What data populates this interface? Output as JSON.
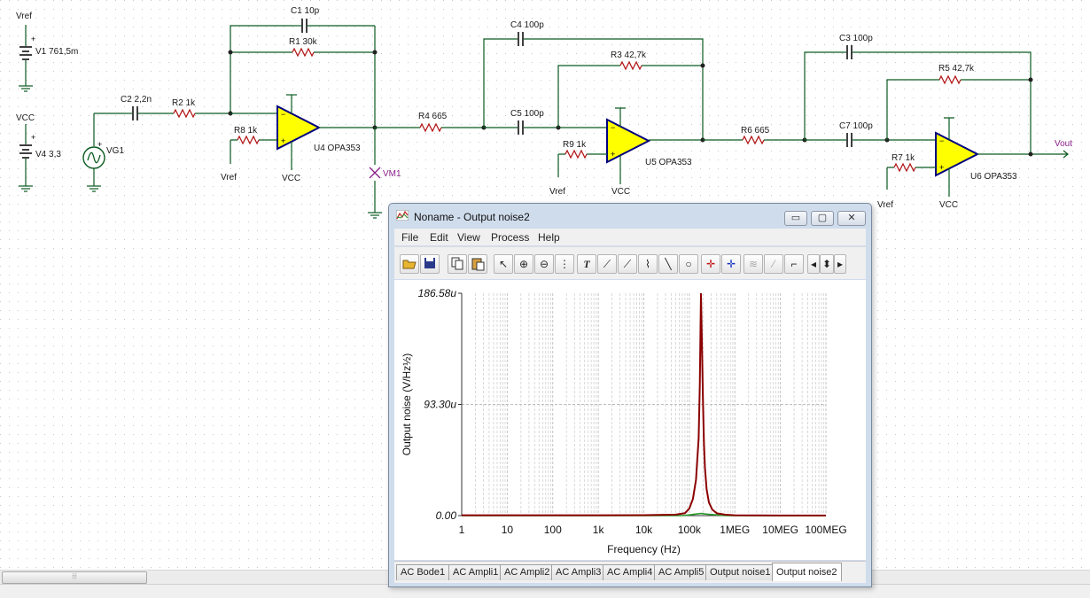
{
  "schematic": {
    "sources": [
      {
        "id": "vref-label",
        "text": "Vref"
      },
      {
        "id": "v1",
        "text": "V1 761,5m"
      },
      {
        "id": "vcc-label",
        "text": "VCC"
      },
      {
        "id": "v4",
        "text": "V4 3,3"
      },
      {
        "id": "vg1",
        "text": "VG1"
      }
    ],
    "components": {
      "c1": "C1 10p",
      "r1": "R1 30k",
      "c2": "C2 2,2n",
      "r2": "R2 1k",
      "r8": "R8 1k",
      "u4": "U4 OPA353",
      "r4": "R4 665",
      "c4": "C4 100p",
      "r3": "R3 42,7k",
      "c5": "C5 100p",
      "r9": "R9 1k",
      "u5": "U5 OPA353",
      "r6": "R6 665",
      "c3": "C3 100p",
      "r5": "R5 42,7k",
      "c7": "C7 100p",
      "r7": "R7 1k",
      "u6": "U6 OPA353"
    },
    "net_labels": {
      "vref_u4": "Vref",
      "vcc_u4": "VCC",
      "vref_u5": "Vref",
      "vcc_u5": "VCC",
      "vref_u6": "Vref",
      "vcc_u6": "VCC",
      "vout": "Vout",
      "vm1": "VM1"
    },
    "colors": {
      "wire": "#0a5a20",
      "opamp_fill": "#ffff00",
      "opamp_stroke": "#000080",
      "probe": "#8a1f8a"
    }
  },
  "window": {
    "title": "Noname - Output noise2",
    "controls": {
      "minimize": "▭",
      "maximize": "▢",
      "close": "✕"
    },
    "menu": [
      "File",
      "Edit",
      "View",
      "Process",
      "Help"
    ],
    "toolbar_icons": [
      "open-folder-icon",
      "save-icon",
      "copy-icon",
      "paste-icon",
      "pointer-icon",
      "zoom-in-icon",
      "zoom-out-icon",
      "grid-icon",
      "text-tool-icon",
      "cursor-a-icon",
      "cursor-b-icon",
      "curve-icon",
      "line-icon",
      "circle-icon",
      "cursor-a-red-icon",
      "cursor-b-blue-icon",
      "waveform-icon",
      "pen-icon",
      "step-icon",
      "arrow-left-icon",
      "arrow-updown-icon",
      "arrow-right-icon"
    ],
    "tabs": [
      "AC Bode1",
      "AC Ampli1",
      "AC Ampli2",
      "AC Ampli3",
      "AC Ampli4",
      "AC Ampli5",
      "Output noise1",
      "Output noise2"
    ],
    "active_tab": "Output noise2"
  },
  "chart_data": {
    "type": "line",
    "title": "",
    "xlabel": "Frequency (Hz)",
    "ylabel": "Output noise (V/Hz½)",
    "xscale": "log",
    "xlim": [
      1,
      100000000
    ],
    "ylim": [
      0,
      186.58
    ],
    "x_tick_labels": [
      "1",
      "10",
      "100",
      "1k",
      "10k",
      "100k",
      "1MEG",
      "10MEG",
      "100MEG"
    ],
    "y_tick_labels": [
      "0.00",
      "93.30u",
      "186.58u"
    ],
    "y_unit": "u",
    "grid": true,
    "series": [
      {
        "color": "#8b0000",
        "x": [
          1,
          10,
          100,
          1000,
          10000,
          50000,
          80000,
          100000,
          120000,
          140000,
          160000,
          170000,
          180000,
          190000,
          200000,
          210000,
          220000,
          240000,
          270000,
          320000,
          400000,
          600000,
          1000000,
          10000000,
          100000000
        ],
        "values": [
          0.3,
          0.3,
          0.3,
          0.3,
          0.4,
          0.8,
          2,
          6,
          14,
          30,
          65,
          110,
          186.58,
          140,
          95,
          60,
          40,
          22,
          11,
          5,
          2,
          0.8,
          0.3,
          0.1,
          0.05
        ]
      },
      {
        "color": "#2a9a2a",
        "x": [
          1,
          70000,
          100000,
          150000,
          180000,
          250000,
          400000,
          600000,
          100000000
        ],
        "values": [
          0,
          0,
          0.6,
          1.4,
          1.8,
          1.2,
          0.6,
          0,
          0
        ]
      }
    ]
  }
}
